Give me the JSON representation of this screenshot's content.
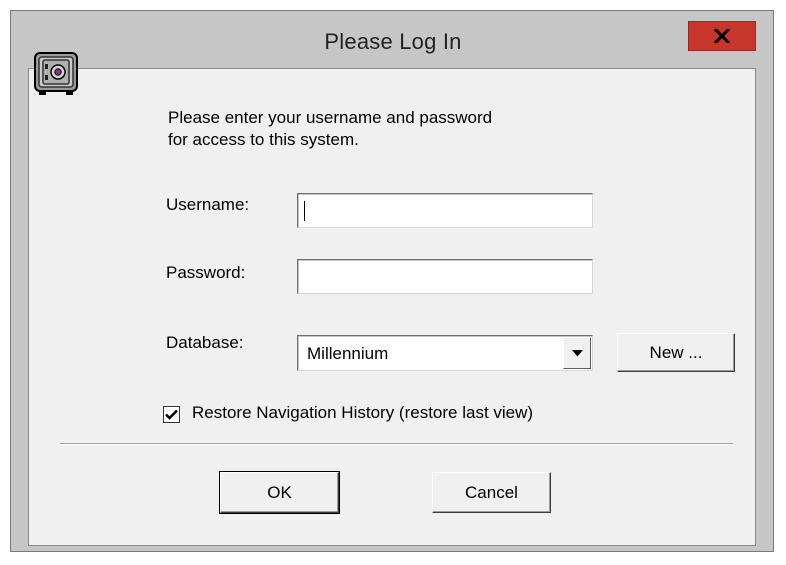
{
  "dialog": {
    "title": "Please Log In",
    "close_glyph": "x"
  },
  "prompt": {
    "line1": "Please enter your username and password",
    "line2": "for access to this system."
  },
  "fields": {
    "username_label": "Username:",
    "username_value": "",
    "password_label": "Password:",
    "password_value": "",
    "database_label": "Database:",
    "database_value": "Millennium"
  },
  "buttons": {
    "new": "New ...",
    "ok": "OK",
    "cancel": "Cancel"
  },
  "options": {
    "restore_history_label": "Restore Navigation History (restore last view)",
    "restore_history_checked": true
  },
  "icons": {
    "dialog_icon": "safe-icon",
    "close": "close-icon",
    "dropdown": "chevron-down-icon",
    "checkbox": "checkmark-icon"
  },
  "colors": {
    "titlebar": "#c6c6c6",
    "close_button": "#c7362b",
    "client_bg": "#f0f0f0"
  }
}
